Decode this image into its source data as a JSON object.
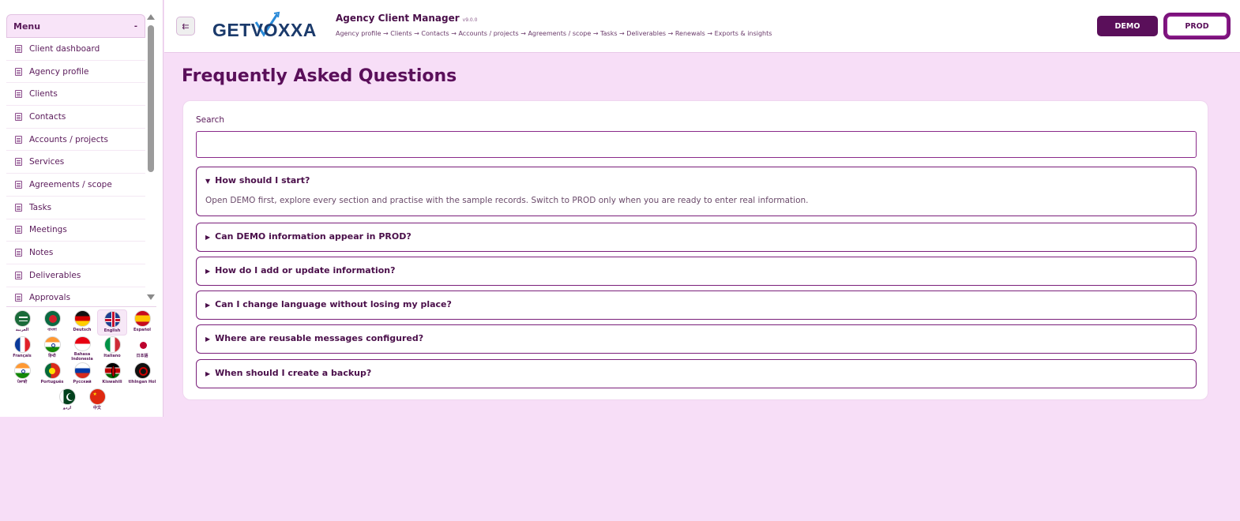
{
  "sidebar": {
    "menu_title": "Menu",
    "menu_caret": "-",
    "items": [
      {
        "label": "Client dashboard"
      },
      {
        "label": "Agency profile"
      },
      {
        "label": "Clients"
      },
      {
        "label": "Contacts"
      },
      {
        "label": "Accounts / projects"
      },
      {
        "label": "Services"
      },
      {
        "label": "Agreements / scope"
      },
      {
        "label": "Tasks"
      },
      {
        "label": "Meetings"
      },
      {
        "label": "Notes"
      },
      {
        "label": "Deliverables"
      },
      {
        "label": "Approvals"
      }
    ],
    "languages": [
      {
        "label": "العربية"
      },
      {
        "label": "বাংলা"
      },
      {
        "label": "Deutsch"
      },
      {
        "label": "English"
      },
      {
        "label": "Español"
      },
      {
        "label": "Français"
      },
      {
        "label": "हिन्दी"
      },
      {
        "label": "Bahasa Indonesia"
      },
      {
        "label": "Italiano"
      },
      {
        "label": "日本語"
      },
      {
        "label": "ਪੰਜਾਬੀ"
      },
      {
        "label": "Português"
      },
      {
        "label": "Русский"
      },
      {
        "label": "Kiswahili"
      },
      {
        "label": "tlhIngan Hol"
      },
      {
        "label": "اردو"
      },
      {
        "label": "中文"
      }
    ]
  },
  "header": {
    "toggle_icon": "⇇",
    "logo_text": "GETVOXXA",
    "app_title": "Agency Client Manager",
    "version": "v9.0.0",
    "breadcrumb": "Agency profile → Clients → Contacts → Accounts / projects → Agreements / scope → Tasks → Deliverables → Renewals → Exports & insights",
    "demo_label": "DEMO",
    "prod_label": "PROD"
  },
  "main": {
    "title": "Frequently Asked Questions",
    "search_label": "Search",
    "search_value": "",
    "faqs": [
      {
        "marker": "▼",
        "question": "How should I start?",
        "answer": "Open DEMO first, explore every section and practise with the sample records. Switch to PROD only when you are ready to enter real information."
      },
      {
        "marker": "▶",
        "question": "Can DEMO information appear in PROD?"
      },
      {
        "marker": "▶",
        "question": "How do I add or update information?"
      },
      {
        "marker": "▶",
        "question": "Can I change language without losing my place?"
      },
      {
        "marker": "▶",
        "question": "Where are reusable messages configured?"
      },
      {
        "marker": "▶",
        "question": "When should I create a backup?"
      }
    ]
  },
  "colors": {
    "background": "#f7def7",
    "accent": "#5a0f5a",
    "border": "#7a1f7a"
  }
}
